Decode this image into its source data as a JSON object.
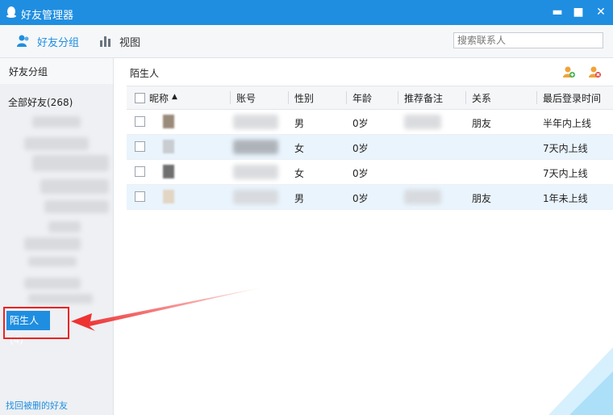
{
  "window": {
    "title": "好友管理器",
    "min_label": "▬",
    "max_label": "■",
    "close_label": "✕",
    "accent": "#1f8ee0"
  },
  "toolbar": {
    "groups_label": "好友分组",
    "view_label": "视图",
    "search_placeholder": "搜索联系人"
  },
  "sidebar": {
    "header": "好友分组",
    "all_friends": "全部好友(268)",
    "stranger_button": "陌生人(4)",
    "recover_link": "找回被删的好友"
  },
  "main": {
    "title": "陌生人",
    "columns": [
      "昵称",
      "账号",
      "性别",
      "年龄",
      "推荐备注",
      "关系",
      "最后登录时间"
    ],
    "sort_indicator": "▲",
    "rows": [
      {
        "gender": "男",
        "age": "0岁",
        "relation": "朋友",
        "last_login": "半年内上线"
      },
      {
        "gender": "女",
        "age": "0岁",
        "relation": "",
        "last_login": "7天内上线"
      },
      {
        "gender": "女",
        "age": "0岁",
        "relation": "",
        "last_login": "7天内上线"
      },
      {
        "gender": "男",
        "age": "0岁",
        "relation": "朋友",
        "last_login": "1年未上线"
      }
    ]
  }
}
